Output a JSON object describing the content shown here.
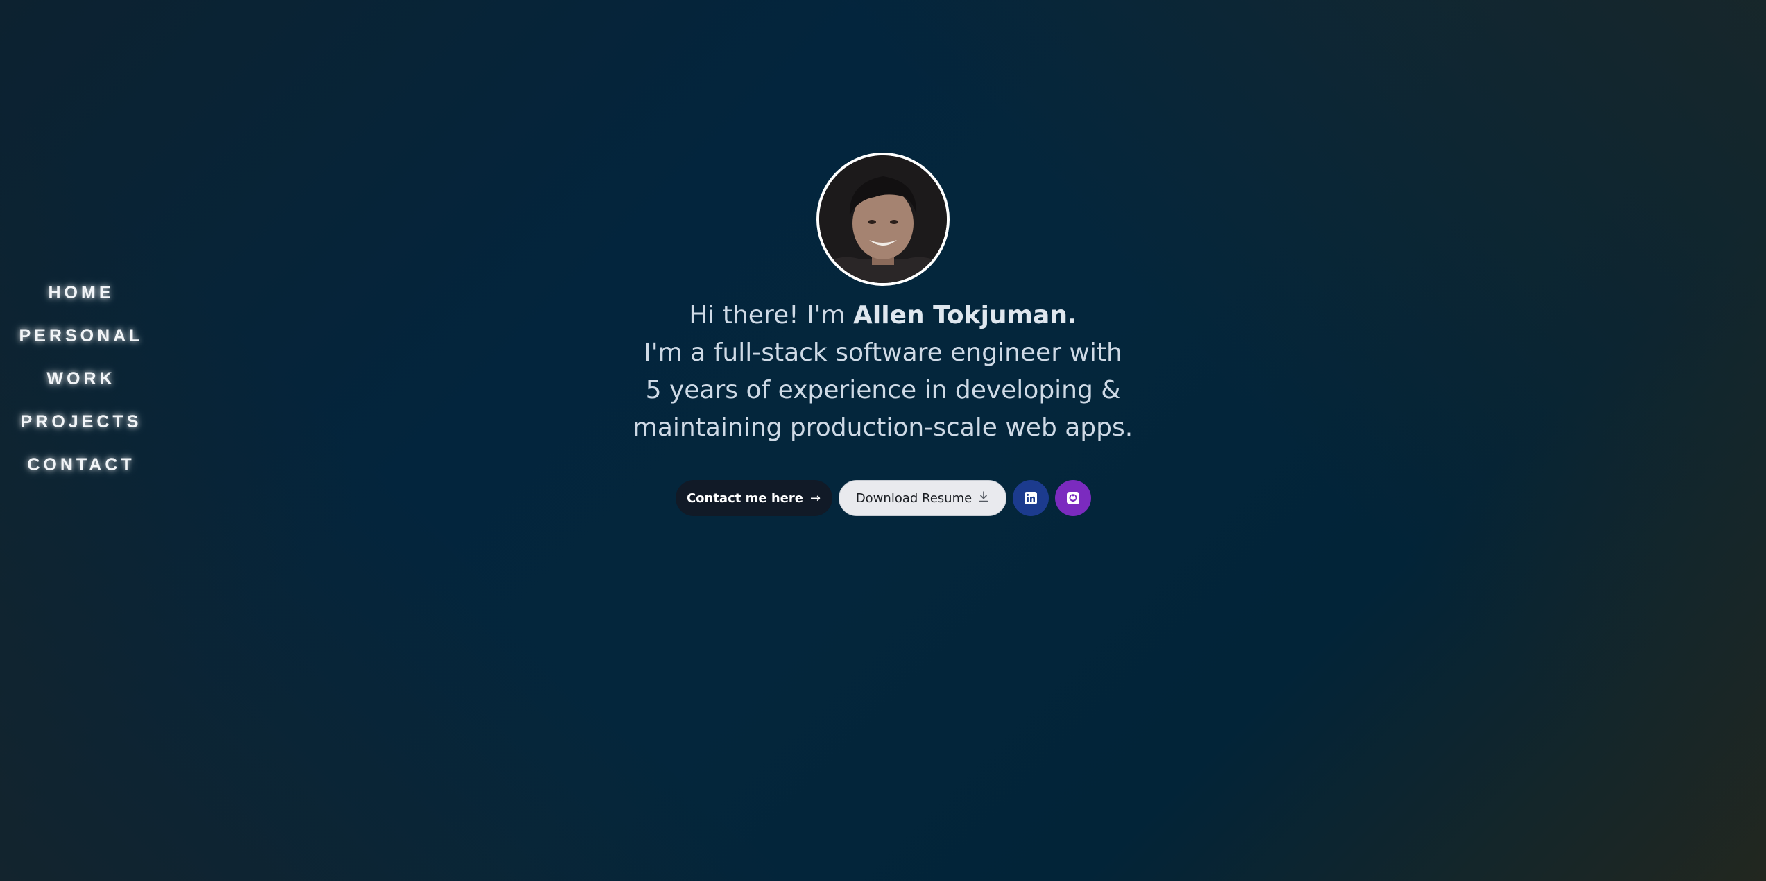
{
  "nav": {
    "items": [
      {
        "label": "HOME"
      },
      {
        "label": "PERSONAL"
      },
      {
        "label": "WORK"
      },
      {
        "label": "PROJECTS"
      },
      {
        "label": "CONTACT"
      }
    ]
  },
  "hero": {
    "greeting_prefix": "Hi there! I'm ",
    "name": "Allen Tokjuman.",
    "lines": [
      "I'm a full-stack software engineer with",
      "5 years of experience in developing &",
      "maintaining production-scale web apps."
    ]
  },
  "actions": {
    "contact_label": "Contact me here",
    "contact_icon": "arrow-right-icon",
    "resume_label": "Download Resume",
    "resume_icon": "download-icon",
    "linkedin_icon": "linkedin-icon",
    "github_icon": "github-icon"
  },
  "colors": {
    "contact_button": "#111a27",
    "resume_button": "#e9eaee",
    "linkedin": "#1c3b8e",
    "github": "#7b2bbf"
  }
}
